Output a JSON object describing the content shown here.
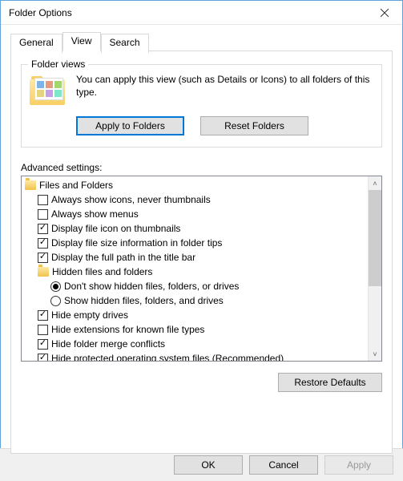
{
  "window": {
    "title": "Folder Options"
  },
  "tabs": {
    "general": "General",
    "view": "View",
    "search": "Search",
    "active": "view"
  },
  "folder_views": {
    "group_label": "Folder views",
    "description": "You can apply this view (such as Details or Icons) to all folders of this type.",
    "apply_label": "Apply to Folders",
    "reset_label": "Reset Folders"
  },
  "advanced": {
    "label": "Advanced settings:",
    "root": "Files and Folders",
    "items": [
      {
        "type": "checkbox",
        "checked": false,
        "label": "Always show icons, never thumbnails"
      },
      {
        "type": "checkbox",
        "checked": false,
        "label": "Always show menus"
      },
      {
        "type": "checkbox",
        "checked": true,
        "label": "Display file icon on thumbnails"
      },
      {
        "type": "checkbox",
        "checked": true,
        "label": "Display file size information in folder tips"
      },
      {
        "type": "checkbox",
        "checked": true,
        "label": "Display the full path in the title bar"
      }
    ],
    "hidden_group": {
      "label": "Hidden files and folders",
      "options": [
        {
          "selected": true,
          "label": "Don't show hidden files, folders, or drives"
        },
        {
          "selected": false,
          "label": "Show hidden files, folders, and drives"
        }
      ]
    },
    "items2": [
      {
        "type": "checkbox",
        "checked": true,
        "label": "Hide empty drives"
      },
      {
        "type": "checkbox",
        "checked": false,
        "label": "Hide extensions for known file types"
      },
      {
        "type": "checkbox",
        "checked": true,
        "label": "Hide folder merge conflicts"
      },
      {
        "type": "checkbox",
        "checked": true,
        "label": "Hide protected operating system files (Recommended)"
      }
    ],
    "restore_label": "Restore Defaults"
  },
  "footer": {
    "ok": "OK",
    "cancel": "Cancel",
    "apply": "Apply"
  }
}
